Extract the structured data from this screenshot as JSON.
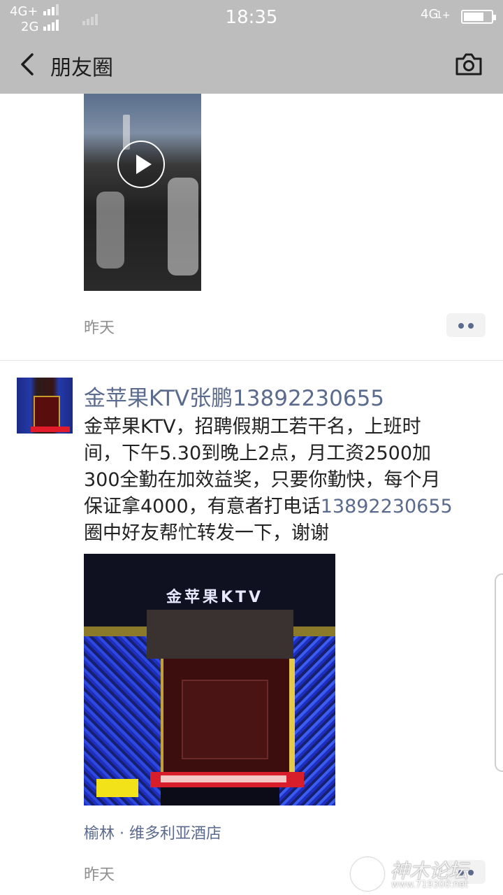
{
  "status_bar": {
    "left_top": "4G+",
    "left_bottom": "2G",
    "time": "18:35",
    "right_network": "4G",
    "right_sub": "1+"
  },
  "nav": {
    "title": "朋友圈",
    "back_icon": "back-chevron-icon",
    "camera_icon": "camera-icon"
  },
  "post1": {
    "time": "昨天"
  },
  "post2": {
    "author": "金苹果KTV张鹏13892230655",
    "text_lines": [
      "金苹果KTV，招聘假期工若干名，上班时",
      "间，下午5.30到晚上2点，月工资2500加",
      "300全勤在加效益奖，只要你勤快，每个月"
    ],
    "text_line4_prefix": "保证拿4000，有意者打电话",
    "text_line4_phone": "13892230655",
    "text_line5": "圈中好友帮忙转发一下，谢谢",
    "photo_sign": "金苹果KTV",
    "location": "榆林 · 维多利亚酒店",
    "time": "昨天"
  },
  "watermark": {
    "text": "神木论坛",
    "url": "www.719300.net"
  },
  "colors": {
    "bar_gray": "#bdbdbd",
    "link_blue": "#5b6b8d",
    "time_gray": "#8e8e8e"
  }
}
